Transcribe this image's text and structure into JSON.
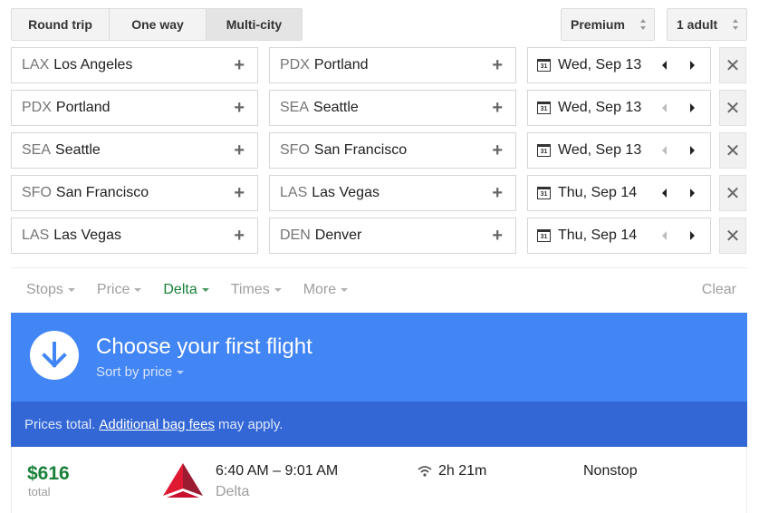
{
  "trip_types": [
    {
      "label": "Round trip",
      "active": false
    },
    {
      "label": "One way",
      "active": false
    },
    {
      "label": "Multi-city",
      "active": true
    }
  ],
  "cabin_class": "Premium",
  "passengers": "1 adult",
  "legs": [
    {
      "from_code": "LAX",
      "from_city": "Los Angeles",
      "to_code": "PDX",
      "to_city": "Portland",
      "date": "Wed, Sep 13",
      "prev_enabled": true
    },
    {
      "from_code": "PDX",
      "from_city": "Portland",
      "to_code": "SEA",
      "to_city": "Seattle",
      "date": "Wed, Sep 13",
      "prev_enabled": false
    },
    {
      "from_code": "SEA",
      "from_city": "Seattle",
      "to_code": "SFO",
      "to_city": "San Francisco",
      "date": "Wed, Sep 13",
      "prev_enabled": false
    },
    {
      "from_code": "SFO",
      "from_city": "San Francisco",
      "to_code": "LAS",
      "to_city": "Las Vegas",
      "date": "Thu, Sep 14",
      "prev_enabled": true
    },
    {
      "from_code": "LAS",
      "from_city": "Las Vegas",
      "to_code": "DEN",
      "to_city": "Denver",
      "date": "Thu, Sep 14",
      "prev_enabled": false
    }
  ],
  "icons": {
    "add": "+",
    "remove": "✕",
    "calendar_day": "31"
  },
  "filters": [
    {
      "label": "Stops",
      "active": false
    },
    {
      "label": "Price",
      "active": false
    },
    {
      "label": "Delta",
      "active": true
    },
    {
      "label": "Times",
      "active": false
    },
    {
      "label": "More",
      "active": false
    }
  ],
  "clear_label": "Clear",
  "banner": {
    "title": "Choose your first flight",
    "sort_label": "Sort by price"
  },
  "notice": {
    "prefix": "Prices total.",
    "link": "Additional bag fees",
    "suffix": "may apply."
  },
  "result": {
    "price": "$616",
    "price_label": "total",
    "times": "6:40 AM – 9:01 AM",
    "airline": "Delta",
    "duration": "2h 21m",
    "stops": "Nonstop"
  },
  "colors": {
    "banner": "#4285f4",
    "notice": "#3367d6",
    "price": "#188038",
    "active_filter": "#188038"
  }
}
